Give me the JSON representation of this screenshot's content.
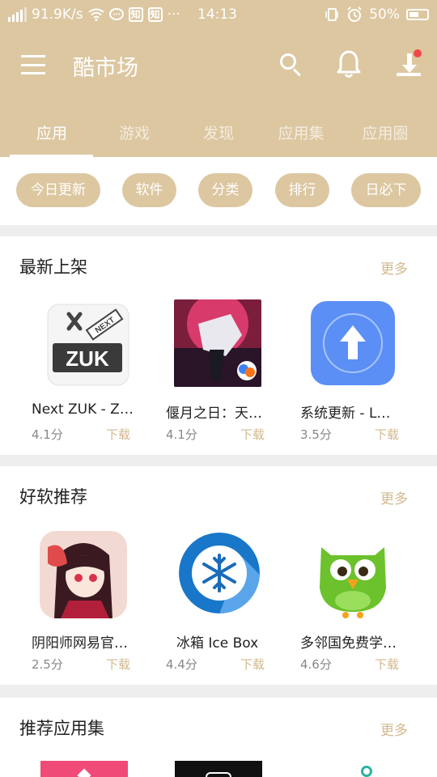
{
  "status_bar": {
    "speed": "91.9K/s",
    "zhi_1": "知",
    "zhi_2": "知",
    "more": "···",
    "time": "14:13",
    "battery": "50%"
  },
  "app_bar": {
    "title": "酷市场",
    "menu_icon": "menu-icon",
    "search_icon": "search-icon",
    "bell_icon": "bell-icon",
    "download_icon": "download-icon",
    "badge_color": "#f04848"
  },
  "tabs": [
    {
      "label": "应用"
    },
    {
      "label": "游戏"
    },
    {
      "label": "发现"
    },
    {
      "label": "应用集"
    },
    {
      "label": "应用圈"
    }
  ],
  "active_tab": "应用",
  "chips": [
    {
      "label": "今日更新"
    },
    {
      "label": "软件"
    },
    {
      "label": "分类"
    },
    {
      "label": "排行"
    },
    {
      "label": "日必下"
    }
  ],
  "sections": [
    {
      "title": "最新上架",
      "more": "更多",
      "apps": [
        {
          "name": "Next ZUK - Z…",
          "rating": "4.1分",
          "download": "下载"
        },
        {
          "name": "偃月之日：天…",
          "rating": "4.1分",
          "download": "下载"
        },
        {
          "name": "系统更新 - L…",
          "rating": "3.5分",
          "download": "下载"
        }
      ]
    },
    {
      "title": "好软推荐",
      "more": "更多",
      "apps": [
        {
          "name": "阴阳师网易官…",
          "rating": "2.5分",
          "download": "下载"
        },
        {
          "name": "冰箱 Ice Box",
          "rating": "4.4分",
          "download": "下载"
        },
        {
          "name": "多邻国免费学…",
          "rating": "4.6分",
          "download": "下载"
        }
      ]
    },
    {
      "title": "推荐应用集",
      "more": "更多",
      "apps": []
    }
  ],
  "icon_texts": {
    "zuk": "ZUK",
    "next": "NEXT"
  },
  "colors": {
    "primary": "#dcc7a1",
    "accent_text": "#d2b98e"
  }
}
